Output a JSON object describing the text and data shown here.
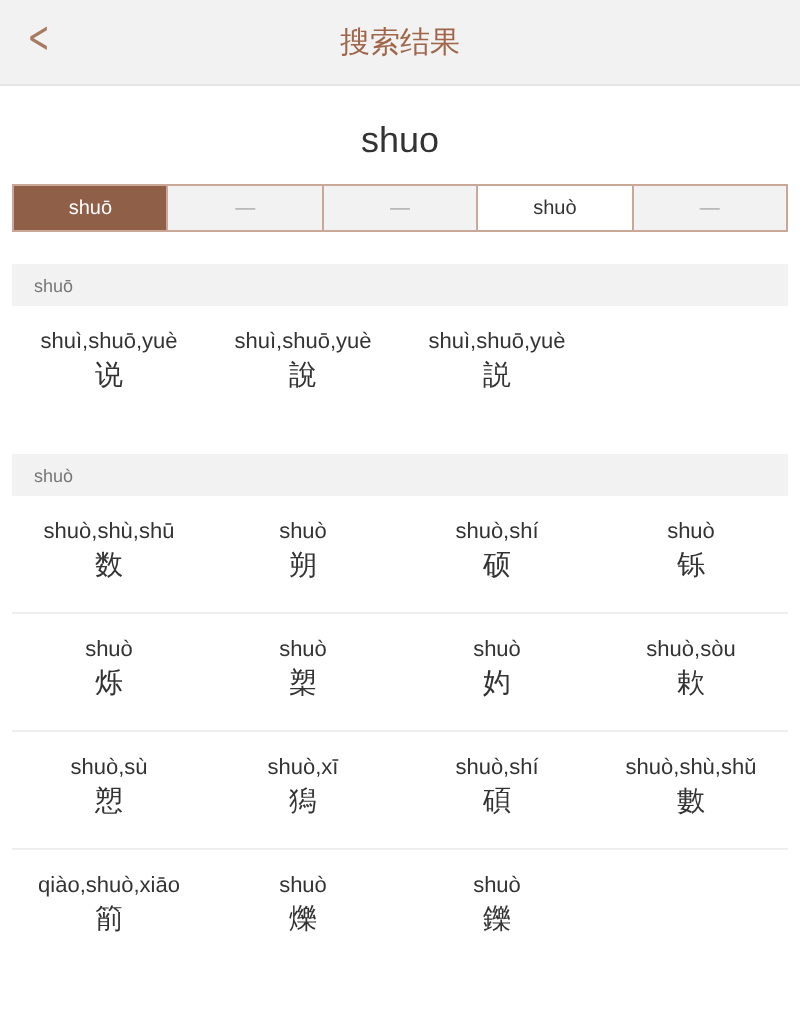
{
  "header": {
    "back": "<",
    "title": "搜索结果"
  },
  "query": "shuo",
  "tones": [
    {
      "label": "shuō",
      "selected": true,
      "disabled": false
    },
    {
      "label": "—",
      "selected": false,
      "disabled": true
    },
    {
      "label": "—",
      "selected": false,
      "disabled": true
    },
    {
      "label": "shuò",
      "selected": false,
      "disabled": false
    },
    {
      "label": "—",
      "selected": false,
      "disabled": true
    }
  ],
  "sections": [
    {
      "title": "shuō",
      "dividers": false,
      "items": [
        {
          "pinyin": "shuì,shuō,yuè",
          "char": "说"
        },
        {
          "pinyin": "shuì,shuō,yuè",
          "char": "說"
        },
        {
          "pinyin": "shuì,shuō,yuè",
          "char": "説"
        }
      ]
    },
    {
      "title": "shuò",
      "dividers": true,
      "items": [
        {
          "pinyin": "shuò,shù,shū",
          "char": "数"
        },
        {
          "pinyin": "shuò",
          "char": "朔"
        },
        {
          "pinyin": "shuò,shí",
          "char": "硕"
        },
        {
          "pinyin": "shuò",
          "char": "铄"
        },
        {
          "pinyin": "shuò",
          "char": "烁"
        },
        {
          "pinyin": "shuò",
          "char": "槊"
        },
        {
          "pinyin": "shuò",
          "char": "妁"
        },
        {
          "pinyin": "shuò,sòu",
          "char": "欶"
        },
        {
          "pinyin": "shuò,sù",
          "char": "愬"
        },
        {
          "pinyin": "shuò,xī",
          "char": "獡"
        },
        {
          "pinyin": "shuò,shí",
          "char": "碩"
        },
        {
          "pinyin": "shuò,shù,shǔ",
          "char": "數"
        },
        {
          "pinyin": "qiào,shuò,xiāo",
          "char": "箾"
        },
        {
          "pinyin": "shuò",
          "char": "爍"
        },
        {
          "pinyin": "shuò",
          "char": "鑠"
        }
      ]
    }
  ]
}
